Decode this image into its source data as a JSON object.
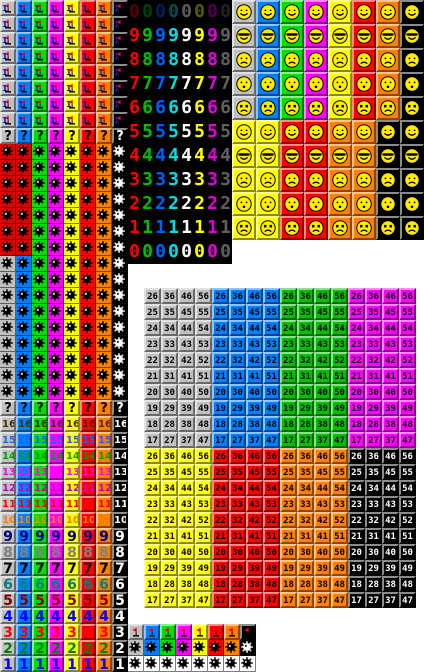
{
  "palettes": {
    "left_columns": [
      "#c0c0c0",
      "#0080ff",
      "#00e000",
      "#ff00ff",
      "#ffff00",
      "#ff0000",
      "#ff8000",
      "#000000"
    ],
    "seg_columns": [
      "#ff0000",
      "#00c000",
      "#0060ff",
      "#00e0e0",
      "#ffffff",
      "#ffff00",
      "#e000e0",
      "#606060"
    ],
    "smile_fills": [
      "#c0c0c0",
      "#0080ff",
      "#00e000",
      "#ff00ff",
      "#ffff00",
      "#ff0000",
      "#ff8000",
      "#000000"
    ],
    "number_fills": [
      "#c0c0c0",
      "#0080ff",
      "#00c000",
      "#ff00ff",
      "#ffff00",
      "#ff0000",
      "#ff8000",
      "#000000"
    ]
  },
  "left_panel": {
    "rows_1_9": [
      {
        "glyph": "1",
        "kind": "flag"
      },
      {
        "glyph": "1",
        "kind": "flag"
      },
      {
        "glyph": "1",
        "kind": "flag"
      },
      {
        "glyph": "1",
        "kind": "flag"
      },
      {
        "glyph": "1",
        "kind": "flag"
      },
      {
        "glyph": "1",
        "kind": "flag"
      },
      {
        "glyph": "1",
        "kind": "flag"
      },
      {
        "glyph": "1",
        "kind": "flag"
      },
      {
        "glyph": "?",
        "kind": "q"
      }
    ],
    "bomb_rows": 16,
    "q_row": "?",
    "number_rows": [
      "16",
      "15",
      "14",
      "13",
      "12",
      "11",
      "10",
      "9",
      "8",
      "7",
      "6",
      "5",
      "4",
      "3",
      "2",
      "1"
    ]
  },
  "segments": {
    "rows": [
      "0",
      "9",
      "8",
      "7",
      "6",
      "5",
      "4",
      "3",
      "2",
      "1",
      "0"
    ],
    "blank_top": ""
  },
  "smiles": {
    "faces": [
      "happy",
      "cool",
      "sad",
      "surprised",
      "dead"
    ]
  },
  "number_grid": {
    "rows": [
      [
        "26",
        "36",
        "46",
        "56"
      ],
      [
        "25",
        "35",
        "45",
        "55"
      ],
      [
        "24",
        "34",
        "44",
        "54"
      ],
      [
        "23",
        "33",
        "43",
        "53"
      ],
      [
        "22",
        "32",
        "42",
        "52"
      ],
      [
        "21",
        "31",
        "41",
        "51"
      ],
      [
        "20",
        "30",
        "40",
        "50"
      ],
      [
        "19",
        "29",
        "39",
        "49"
      ],
      [
        "18",
        "28",
        "38",
        "48"
      ],
      [
        "17",
        "27",
        "37",
        "47"
      ]
    ]
  },
  "bottom_strip": {
    "flag_count": 8,
    "mine_count": 8
  }
}
